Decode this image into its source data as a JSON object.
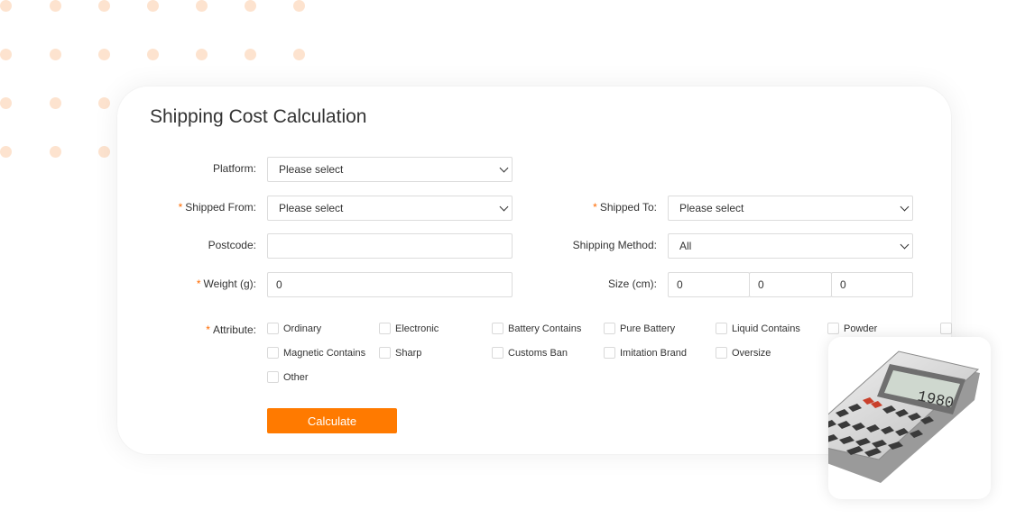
{
  "form": {
    "title": "Shipping Cost Calculation",
    "required_mark": "*",
    "platform": {
      "label": "Platform:",
      "value": "Please select"
    },
    "shipped_from": {
      "label": "Shipped From:",
      "value": "Please select"
    },
    "shipped_to": {
      "label": "Shipped To:",
      "value": "Please select"
    },
    "postcode": {
      "label": "Postcode:",
      "value": ""
    },
    "shipping_method": {
      "label": "Shipping Method:",
      "value": "All"
    },
    "weight": {
      "label": "Weight (g):",
      "value": "0"
    },
    "size": {
      "label": "Size (cm):",
      "values": [
        "0",
        "0",
        "0"
      ]
    },
    "attribute": {
      "label": "Attribute:",
      "options": [
        "Ordinary",
        "Electronic",
        "Battery Contains",
        "Pure Battery",
        "Liquid Contains",
        "Powder",
        "Magnetic Contains",
        "Sharp",
        "Customs Ban",
        "Imitation Brand",
        "Oversize",
        "Other"
      ]
    },
    "calculate_label": "Calculate"
  },
  "calculator_display": "1980",
  "colors": {
    "accent": "#ff7a00",
    "dot": "#fde3cf"
  }
}
